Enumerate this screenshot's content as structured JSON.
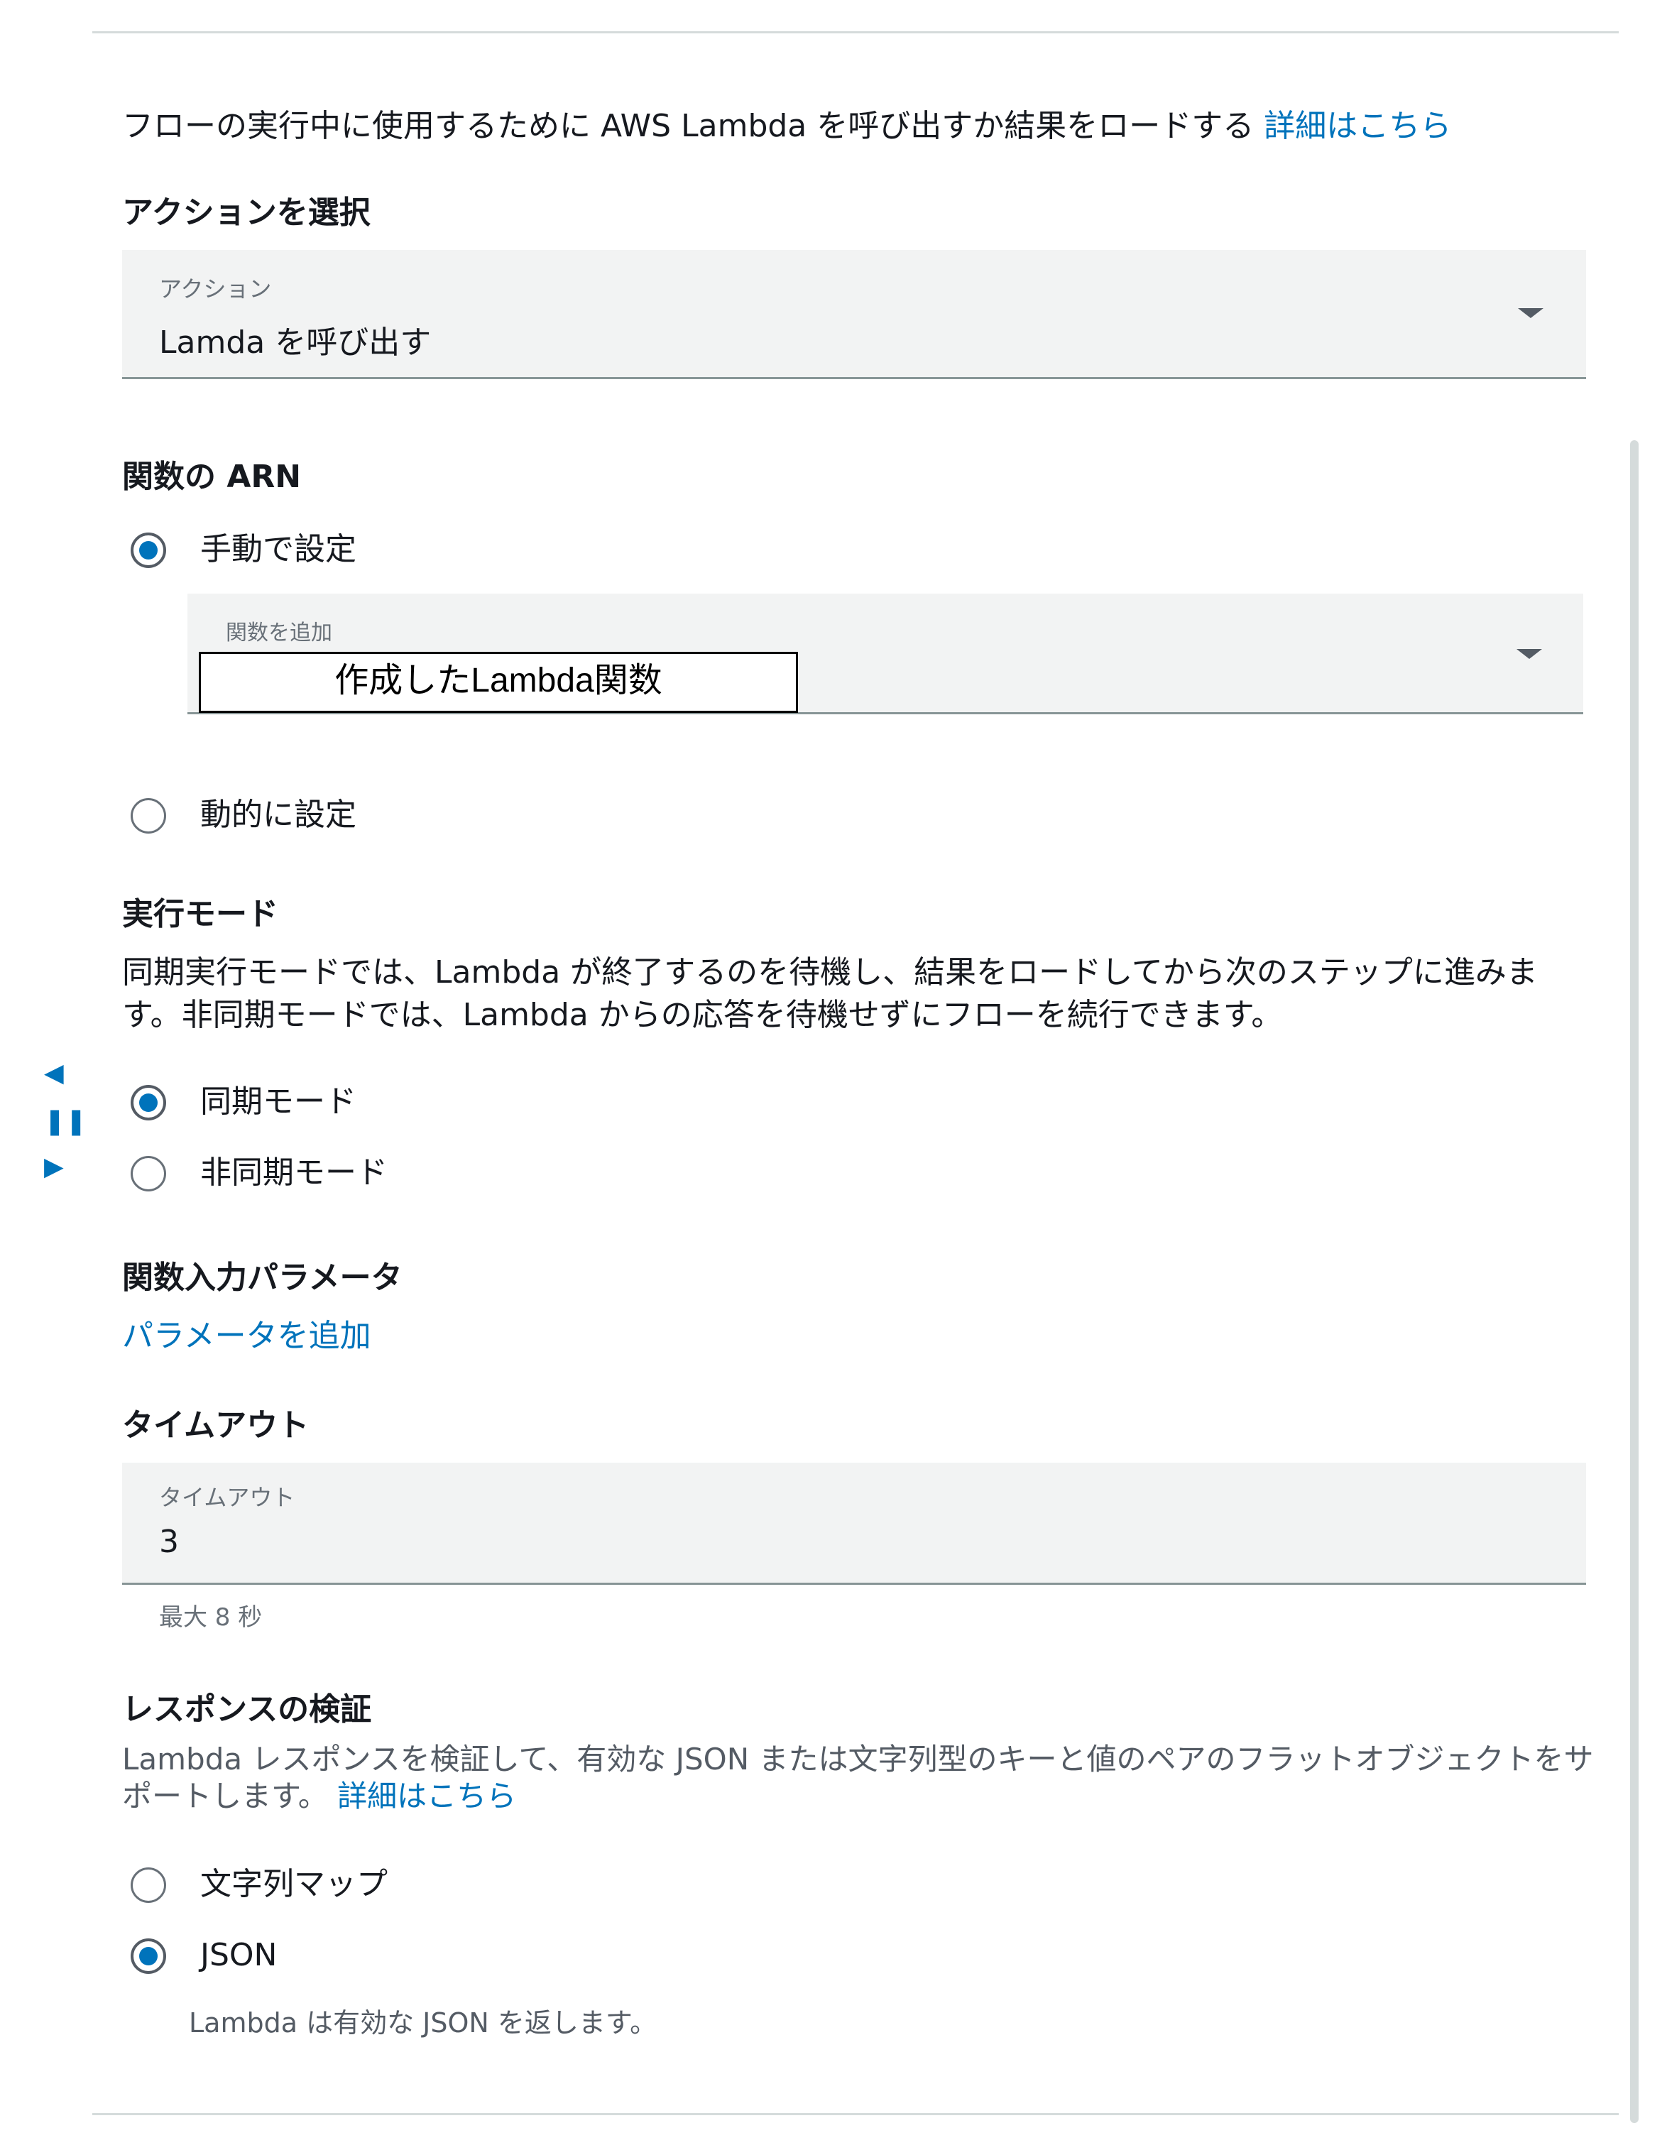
{
  "intro": {
    "text": "フローの実行中に使用するために AWS Lambda を呼び出すか結果をロードする",
    "link": "詳細はこちら"
  },
  "action": {
    "heading": "アクションを選択",
    "field_label": "アクション",
    "value": "Lamda を呼び出す",
    "caret_icon": "caret-down-icon"
  },
  "arn": {
    "heading": "関数の ARN",
    "manual_label": "手動で設定",
    "manual_selected": true,
    "function_field_label": "関数を追加",
    "function_value": "作成したLambda関数",
    "dynamic_label": "動的に設定",
    "dynamic_selected": false
  },
  "exec_mode": {
    "heading": "実行モード",
    "description_line1": "同期実行モードでは、Lambda が終了するのを待機し、結果をロードしてから次のステップに進みま",
    "description_line2": "す。非同期モードでは、Lambda からの応答を待機せずにフローを続行できます。",
    "sync_label": "同期モード",
    "sync_selected": true,
    "async_label": "非同期モード",
    "async_selected": false
  },
  "params": {
    "heading": "関数入力パラメータ",
    "add_link": "パラメータを追加"
  },
  "timeout": {
    "heading": "タイムアウト",
    "field_label": "タイムアウト",
    "value": "3",
    "helper": "最大 8 秒"
  },
  "validation": {
    "heading": "レスポンスの検証",
    "description_line1": "Lambda レスポンスを検証して、有効な JSON または文字列型のキーと値のペアのフラットオブジェクトをサ",
    "description_line2": "ポートします。",
    "link": "詳細はこちら",
    "string_map_label": "文字列マップ",
    "string_map_selected": false,
    "json_label": "JSON",
    "json_selected": true,
    "json_helper": "Lambda は有効な JSON を返します。"
  },
  "side_controls": {
    "prev_icon": "triangle-left-icon",
    "pause_icon": "pause-icon",
    "next_icon": "triangle-right-icon"
  },
  "colors": {
    "link": "#0073bb",
    "radio_fill": "#0073bb",
    "field_bg": "#f2f3f3",
    "divider": "#d5dbdb"
  }
}
